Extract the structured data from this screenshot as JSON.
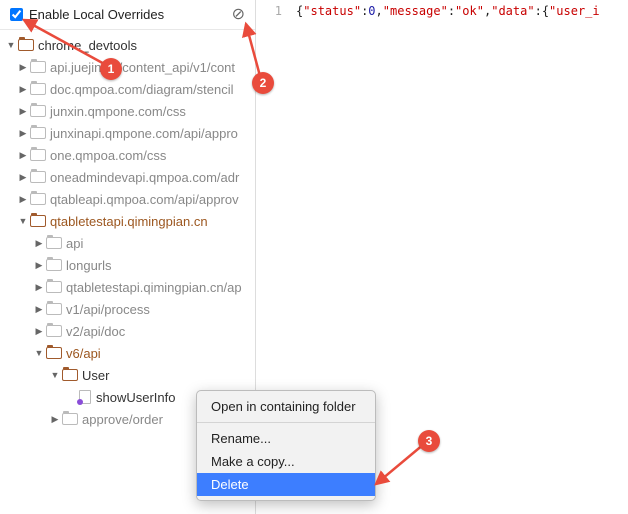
{
  "toolbar": {
    "enable_label": "Enable Local Overrides",
    "checked": true
  },
  "tree": {
    "root": "chrome_devtools",
    "nodes": [
      {
        "label": "api.juejin.cn/content_api/v1/cont",
        "depth": 2
      },
      {
        "label": "doc.qmpoa.com/diagram/stencil",
        "depth": 2
      },
      {
        "label": "junxin.qmpone.com/css",
        "depth": 2
      },
      {
        "label": "junxinapi.qmpone.com/api/appro",
        "depth": 2
      },
      {
        "label": "one.qmpoa.com/css",
        "depth": 2
      },
      {
        "label": "oneadmindevapi.qmpoa.com/adr",
        "depth": 2
      },
      {
        "label": "qtableapi.qmpoa.com/api/approv",
        "depth": 2
      }
    ],
    "active_folder": "qtabletestapi.qimingpian.cn",
    "active_children": [
      {
        "label": "api"
      },
      {
        "label": "longurls"
      },
      {
        "label": "qtabletestapi.qimingpian.cn/ap"
      },
      {
        "label": "v1/api/process"
      },
      {
        "label": "v2/api/doc"
      }
    ],
    "v6": "v6/api",
    "user": "User",
    "file": "showUserInfo",
    "approve": "approve/order"
  },
  "editor": {
    "line_no": "1",
    "json_keys": {
      "status": "status",
      "message": "message",
      "data": "data",
      "user_i": "user_i"
    },
    "json_vals": {
      "zero": "0",
      "ok": "ok"
    }
  },
  "context_menu": {
    "open": "Open in containing folder",
    "rename": "Rename...",
    "copy": "Make a copy...",
    "delete": "Delete"
  },
  "callouts": {
    "c1": "1",
    "c2": "2",
    "c3": "3"
  }
}
